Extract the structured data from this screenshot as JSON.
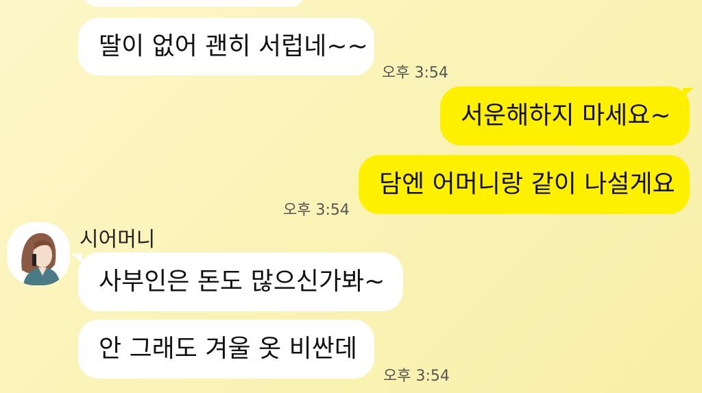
{
  "conversation": {
    "messages": [
      {
        "id": "m1",
        "direction": "incoming",
        "text": "딸이 없어 괜히 서럽네~~"
      },
      {
        "id": "m2",
        "direction": "outgoing",
        "text": "서운해하지 마세요~"
      },
      {
        "id": "m3",
        "direction": "outgoing",
        "text": "담엔 어머니랑 같이 나설게요"
      },
      {
        "id": "m4",
        "direction": "incoming",
        "text": "사부인은 돈도 많으신가봐~"
      },
      {
        "id": "m5",
        "direction": "incoming",
        "text": "안 그래도 겨울 옷 비싼데"
      }
    ],
    "timestamps": {
      "t1": "오후 3:54",
      "t2": "오후 3:54",
      "t3": "오후 3:54"
    },
    "sender": {
      "name": "시어머니",
      "avatar_icon": "woman-on-phone-avatar"
    }
  },
  "colors": {
    "background": "#faf3b6",
    "incoming_bubble": "#ffffff",
    "outgoing_bubble": "#fff000"
  }
}
